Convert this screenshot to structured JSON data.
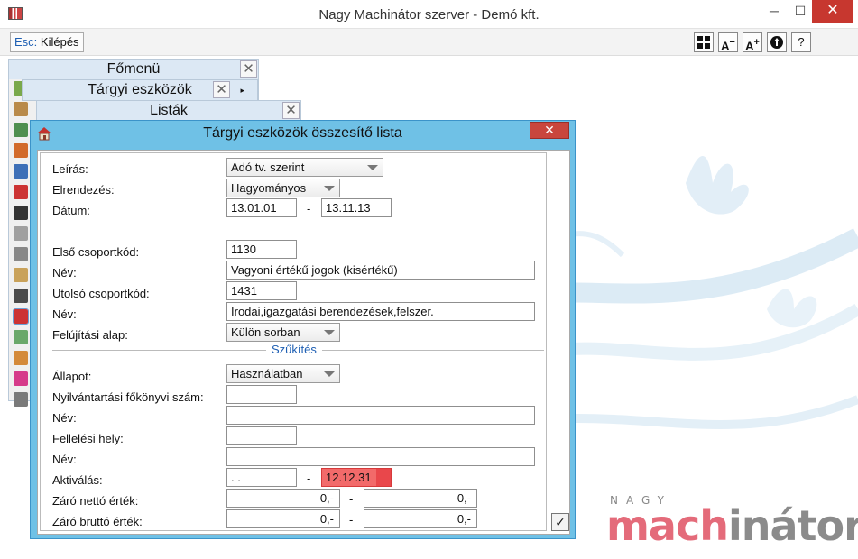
{
  "window": {
    "title": "Nagy Machinátor szerver - Demó kft.",
    "min": "─",
    "max": "☐",
    "close": "✕"
  },
  "toolbar": {
    "esc_key": "Esc:",
    "esc_label": " Kilépés",
    "font_down": "A",
    "font_up": "A",
    "help": "?"
  },
  "menus": {
    "main": "Főmenü",
    "sub": "Tárgyi eszközök",
    "lists": "Listák",
    "close_glyph": "✕",
    "arrow": "▸"
  },
  "dialog": {
    "title": "Tárgyi eszközök összesítő lista",
    "close": "✕",
    "ok": "✓",
    "fields": {
      "leiras_label": "Leírás:",
      "leiras_value": "Adó tv. szerint",
      "elrendezes_label": "Elrendezés:",
      "elrendezes_value": "Hagyományos",
      "datum_label": "Dátum:",
      "datum_from": "13.01.01",
      "datum_to": "13.11.13",
      "elso_label": "Első csoportkód:",
      "elso_value": "1130",
      "nev1_label": "Név:",
      "nev1_value": "Vagyoni értékű jogok (kisértékű)",
      "utolso_label": "Utolsó csoportkód:",
      "utolso_value": "1431",
      "nev2_label": "Név:",
      "nev2_value": "Irodai,igazgatási berendezések,felszer.",
      "felujitasi_label": "Felújítási alap:",
      "felujitasi_value": "Külön sorban",
      "szukites": "Szűkítés",
      "allapot_label": "Állapot:",
      "allapot_value": "Használatban",
      "fokonyv_label": "Nyilvántartási főkönyvi szám:",
      "fokonyv_value": "",
      "nev3_label": "Név:",
      "nev3_value": "",
      "fellelesi_label": "Fellelési hely:",
      "fellelesi_value": "",
      "nev4_label": "Név:",
      "nev4_value": "",
      "aktivalas_label": "Aktiválás:",
      "aktivalas_from": " .  .",
      "aktivalas_to": "12.12.31",
      "netto_label": "Záró nettó érték:",
      "netto_from": "0,-",
      "netto_to": "0,-",
      "brutto_label": "Záró bruttó érték:",
      "brutto_from": "0,-",
      "brutto_to": "0,-",
      "dash": "-"
    }
  },
  "brand": {
    "small": "NAGY",
    "mach": "mach",
    "inator": "inátor"
  },
  "colors": {
    "dialog_frame": "#6fc1e6",
    "close_red": "#c7372f",
    "active_field": "#f26a6a",
    "accent_blue": "#1e5fb3",
    "brand_pink": "#e46b7a"
  }
}
